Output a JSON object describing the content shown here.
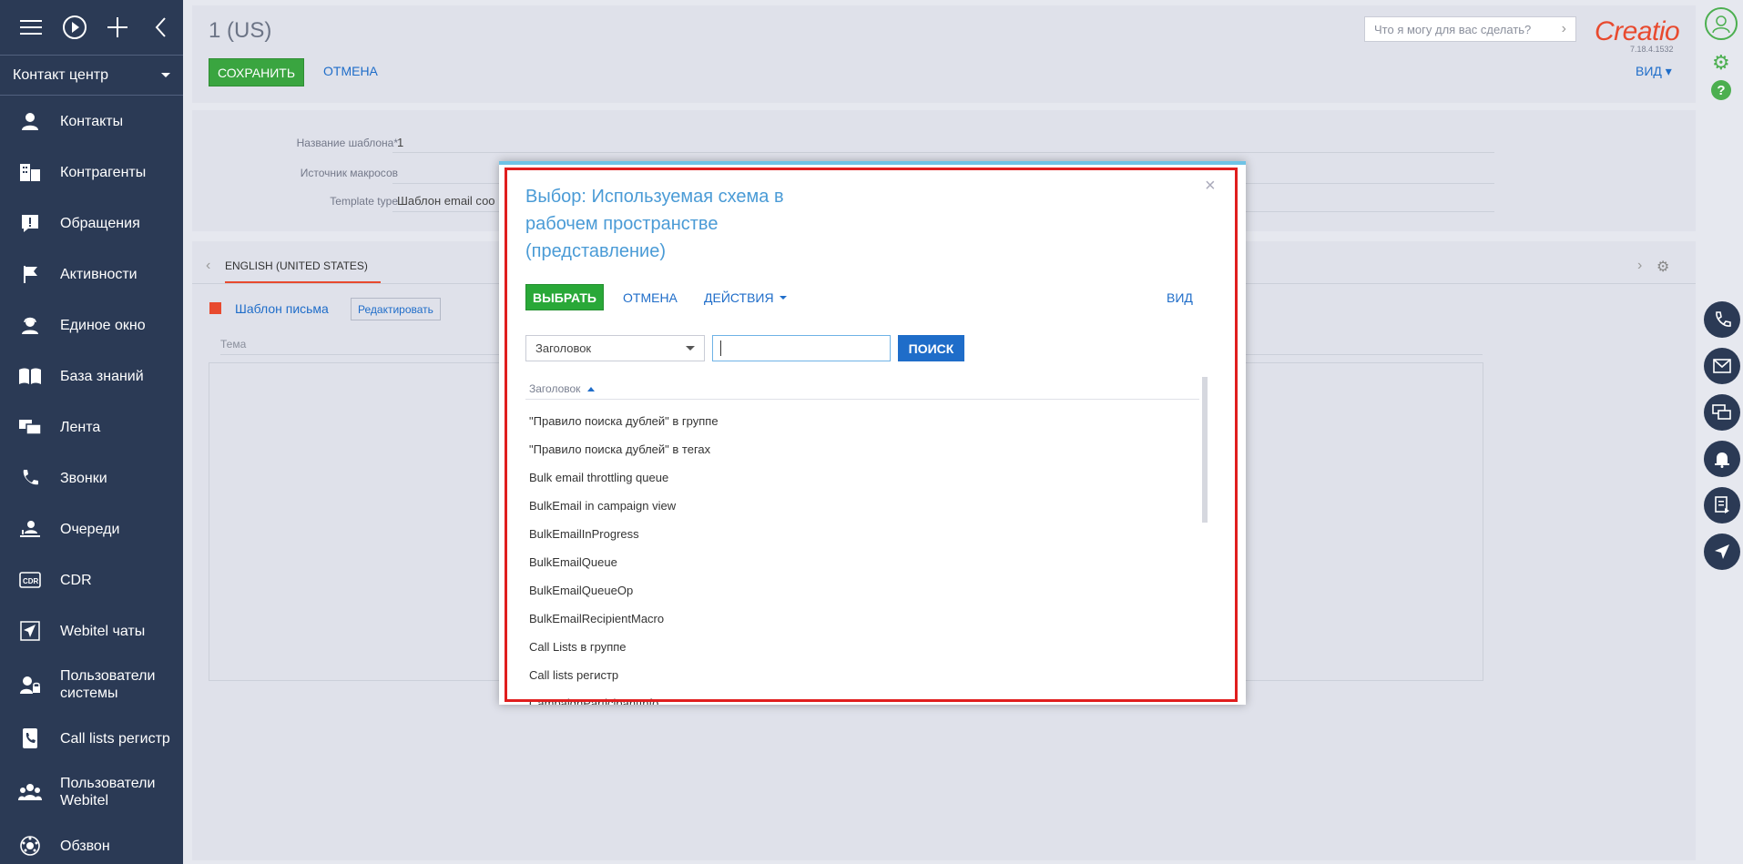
{
  "sidebar": {
    "workspace": "Контакт центр",
    "items": [
      {
        "label": "Контакты",
        "icon": "person-icon"
      },
      {
        "label": "Контрагенты",
        "icon": "building-icon"
      },
      {
        "label": "Обращения",
        "icon": "exclamation-icon"
      },
      {
        "label": "Активности",
        "icon": "flag-icon"
      },
      {
        "label": "Единое окно",
        "icon": "person-headset-icon"
      },
      {
        "label": "База знаний",
        "icon": "book-icon"
      },
      {
        "label": "Лента",
        "icon": "feed-icon"
      },
      {
        "label": "Звонки",
        "icon": "phone-icon"
      },
      {
        "label": "Очереди",
        "icon": "queue-icon"
      },
      {
        "label": "CDR",
        "icon": "cdr-icon"
      },
      {
        "label": "Webitel чаты",
        "icon": "send-icon"
      },
      {
        "label": "Пользователи\nсистемы",
        "icon": "user-lock-icon"
      },
      {
        "label": "Call lists регистр",
        "icon": "phone-book-icon"
      },
      {
        "label": "Пользователи\nWebitel",
        "icon": "users-icon"
      },
      {
        "label": "Обзвон",
        "icon": "dialer-icon"
      }
    ]
  },
  "header": {
    "title": "1 (US)",
    "save": "СОХРАНИТЬ",
    "cancel": "ОТМЕНА",
    "search_placeholder": "Что я могу для вас сделать?",
    "logo": "Creatio",
    "version": "7.18.4.1532",
    "view": "ВИД"
  },
  "fields": {
    "name_label": "Название шаблона*",
    "name_value": "1",
    "macro_label": "Источник макросов",
    "macro_value": "",
    "type_label": "Template type",
    "type_value": "Шаблон email соо"
  },
  "tabs": {
    "active": "ENGLISH (UNITED STATES)",
    "email_template": "Шаблон письма",
    "edit": "Редактировать",
    "subject": "Тема"
  },
  "modal": {
    "title": "Выбор: Используемая схема в рабочем пространстве (представление)",
    "select": "ВЫБРАТЬ",
    "cancel": "ОТМЕНА",
    "actions": "ДЕЙСТВИЯ",
    "view": "ВИД",
    "filter_column": "Заголовок",
    "search": "ПОИСК",
    "column_header": "Заголовок",
    "rows": [
      "\"Правило поиска дублей\" в группе",
      "\"Правило поиска дублей\" в тегах",
      "Bulk email throttling queue",
      "BulkEmail in campaign view",
      "BulkEmailInProgress",
      "BulkEmailQueue",
      "BulkEmailQueueOp",
      "BulkEmailRecipientMacro",
      "Call Lists в группе",
      "Call lists регистр",
      "CampaignParticipantInfo"
    ]
  }
}
